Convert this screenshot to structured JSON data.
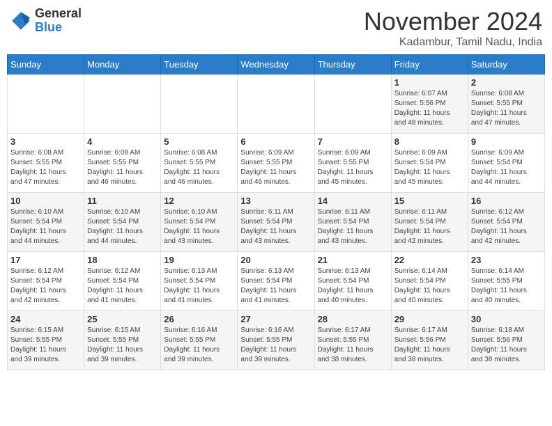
{
  "header": {
    "logo_general": "General",
    "logo_blue": "Blue",
    "month_title": "November 2024",
    "location": "Kadambur, Tamil Nadu, India"
  },
  "days_of_week": [
    "Sunday",
    "Monday",
    "Tuesday",
    "Wednesday",
    "Thursday",
    "Friday",
    "Saturday"
  ],
  "weeks": [
    [
      {
        "day": "",
        "info": ""
      },
      {
        "day": "",
        "info": ""
      },
      {
        "day": "",
        "info": ""
      },
      {
        "day": "",
        "info": ""
      },
      {
        "day": "",
        "info": ""
      },
      {
        "day": "1",
        "info": "Sunrise: 6:07 AM\nSunset: 5:56 PM\nDaylight: 11 hours\nand 48 minutes."
      },
      {
        "day": "2",
        "info": "Sunrise: 6:08 AM\nSunset: 5:55 PM\nDaylight: 11 hours\nand 47 minutes."
      }
    ],
    [
      {
        "day": "3",
        "info": "Sunrise: 6:08 AM\nSunset: 5:55 PM\nDaylight: 11 hours\nand 47 minutes."
      },
      {
        "day": "4",
        "info": "Sunrise: 6:08 AM\nSunset: 5:55 PM\nDaylight: 11 hours\nand 46 minutes."
      },
      {
        "day": "5",
        "info": "Sunrise: 6:08 AM\nSunset: 5:55 PM\nDaylight: 11 hours\nand 46 minutes."
      },
      {
        "day": "6",
        "info": "Sunrise: 6:09 AM\nSunset: 5:55 PM\nDaylight: 11 hours\nand 46 minutes."
      },
      {
        "day": "7",
        "info": "Sunrise: 6:09 AM\nSunset: 5:55 PM\nDaylight: 11 hours\nand 45 minutes."
      },
      {
        "day": "8",
        "info": "Sunrise: 6:09 AM\nSunset: 5:54 PM\nDaylight: 11 hours\nand 45 minutes."
      },
      {
        "day": "9",
        "info": "Sunrise: 6:09 AM\nSunset: 5:54 PM\nDaylight: 11 hours\nand 44 minutes."
      }
    ],
    [
      {
        "day": "10",
        "info": "Sunrise: 6:10 AM\nSunset: 5:54 PM\nDaylight: 11 hours\nand 44 minutes."
      },
      {
        "day": "11",
        "info": "Sunrise: 6:10 AM\nSunset: 5:54 PM\nDaylight: 11 hours\nand 44 minutes."
      },
      {
        "day": "12",
        "info": "Sunrise: 6:10 AM\nSunset: 5:54 PM\nDaylight: 11 hours\nand 43 minutes."
      },
      {
        "day": "13",
        "info": "Sunrise: 6:11 AM\nSunset: 5:54 PM\nDaylight: 11 hours\nand 43 minutes."
      },
      {
        "day": "14",
        "info": "Sunrise: 6:11 AM\nSunset: 5:54 PM\nDaylight: 11 hours\nand 43 minutes."
      },
      {
        "day": "15",
        "info": "Sunrise: 6:11 AM\nSunset: 5:54 PM\nDaylight: 11 hours\nand 42 minutes."
      },
      {
        "day": "16",
        "info": "Sunrise: 6:12 AM\nSunset: 5:54 PM\nDaylight: 11 hours\nand 42 minutes."
      }
    ],
    [
      {
        "day": "17",
        "info": "Sunrise: 6:12 AM\nSunset: 5:54 PM\nDaylight: 11 hours\nand 42 minutes."
      },
      {
        "day": "18",
        "info": "Sunrise: 6:12 AM\nSunset: 5:54 PM\nDaylight: 11 hours\nand 41 minutes."
      },
      {
        "day": "19",
        "info": "Sunrise: 6:13 AM\nSunset: 5:54 PM\nDaylight: 11 hours\nand 41 minutes."
      },
      {
        "day": "20",
        "info": "Sunrise: 6:13 AM\nSunset: 5:54 PM\nDaylight: 11 hours\nand 41 minutes."
      },
      {
        "day": "21",
        "info": "Sunrise: 6:13 AM\nSunset: 5:54 PM\nDaylight: 11 hours\nand 40 minutes."
      },
      {
        "day": "22",
        "info": "Sunrise: 6:14 AM\nSunset: 5:54 PM\nDaylight: 11 hours\nand 40 minutes."
      },
      {
        "day": "23",
        "info": "Sunrise: 6:14 AM\nSunset: 5:55 PM\nDaylight: 11 hours\nand 40 minutes."
      }
    ],
    [
      {
        "day": "24",
        "info": "Sunrise: 6:15 AM\nSunset: 5:55 PM\nDaylight: 11 hours\nand 39 minutes."
      },
      {
        "day": "25",
        "info": "Sunrise: 6:15 AM\nSunset: 5:55 PM\nDaylight: 11 hours\nand 39 minutes."
      },
      {
        "day": "26",
        "info": "Sunrise: 6:16 AM\nSunset: 5:55 PM\nDaylight: 11 hours\nand 39 minutes."
      },
      {
        "day": "27",
        "info": "Sunrise: 6:16 AM\nSunset: 5:55 PM\nDaylight: 11 hours\nand 39 minutes."
      },
      {
        "day": "28",
        "info": "Sunrise: 6:17 AM\nSunset: 5:55 PM\nDaylight: 11 hours\nand 38 minutes."
      },
      {
        "day": "29",
        "info": "Sunrise: 6:17 AM\nSunset: 5:56 PM\nDaylight: 11 hours\nand 38 minutes."
      },
      {
        "day": "30",
        "info": "Sunrise: 6:18 AM\nSunset: 5:56 PM\nDaylight: 11 hours\nand 38 minutes."
      }
    ]
  ]
}
